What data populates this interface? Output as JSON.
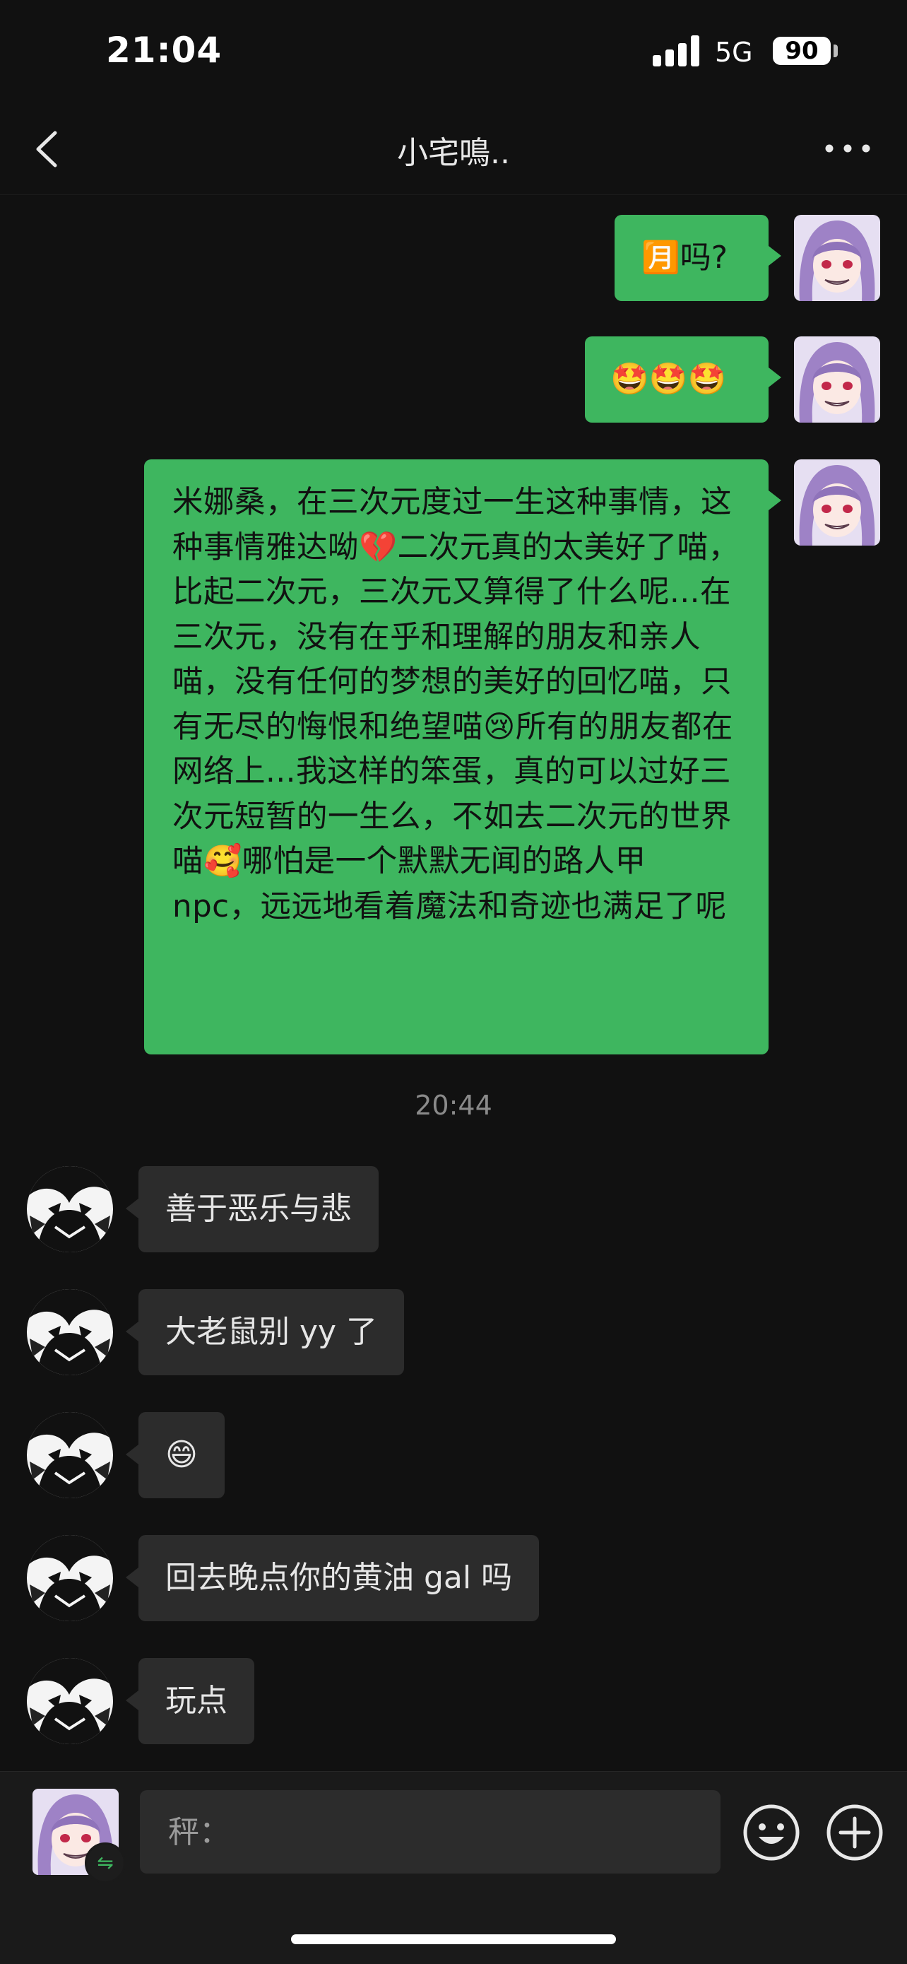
{
  "status": {
    "time": "21:04",
    "network": "5G",
    "battery": "90"
  },
  "nav": {
    "title": "小宅鳴.."
  },
  "messages_out": [
    {
      "text": "🈷️吗?"
    },
    {
      "text": "🤩🤩🤩"
    },
    {
      "text": "米娜桑，在三次元度过一生这种事情，这种事情雅达呦💔二次元真的太美好了喵，比起二次元，三次元又算得了什么呢...在三次元，没有在乎和理解的朋友和亲人喵，没有任何的梦想的美好的回忆喵，只有无尽的悔恨和绝望喵😢所有的朋友都在网络上...我这样的笨蛋，真的可以过好三次元短暂的一生么，不如去二次元的世界喵🥰哪怕是一个默默无闻的路人甲 npc，远远地看着魔法和奇迹也满足了呢"
    }
  ],
  "timestamp": "20:44",
  "messages_in": [
    {
      "text": "善于恶乐与悲"
    },
    {
      "text": "大老鼠别 yy 了"
    },
    {
      "text": "😄"
    },
    {
      "text": "回去晚点你的黄油 gal 吗"
    },
    {
      "text": "玩点"
    }
  ],
  "input": {
    "placeholder": "秤："
  },
  "colors": {
    "background": "#111111",
    "bubble_out": "#3eb65f",
    "bubble_in": "#2c2c2c",
    "input_bar": "#1a1a1a"
  },
  "icons": [
    "back-icon",
    "more-icon",
    "emoji-icon",
    "plus-icon",
    "switch-icon"
  ]
}
